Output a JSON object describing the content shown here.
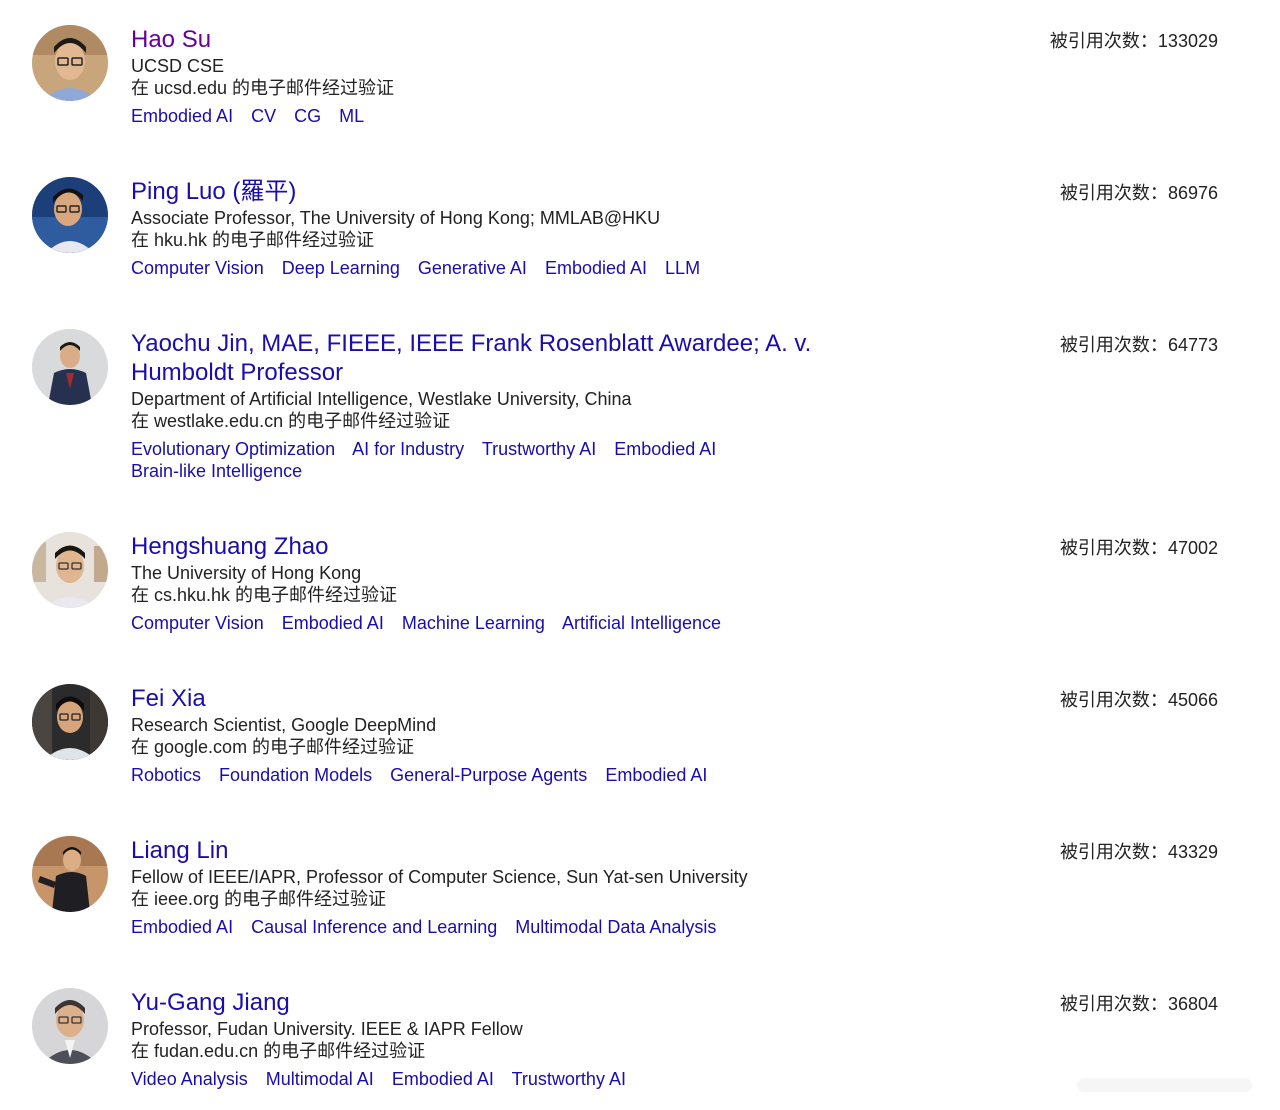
{
  "cite_label": "被引用次数：",
  "profiles": [
    {
      "name": "Hao Su",
      "affiliation": "UCSD CSE",
      "email": "在 ucsd.edu 的电子邮件经过验证",
      "citations": "133029",
      "tags": [
        "Embodied AI",
        "CV",
        "CG",
        "ML"
      ]
    },
    {
      "name": "Ping Luo (羅平)",
      "affiliation": "Associate Professor, The University of Hong Kong; MMLAB@HKU",
      "email": "在 hku.hk 的电子邮件经过验证",
      "citations": "86976",
      "tags": [
        "Computer Vision",
        "Deep Learning",
        "Generative AI",
        "Embodied AI",
        "LLM"
      ]
    },
    {
      "name_lines": [
        "Yaochu Jin, MAE, FIEEE, IEEE Frank Rosenblatt Awardee; A. v.",
        "Humboldt Professor"
      ],
      "affiliation": "Department of Artificial Intelligence, Westlake University, China",
      "email": "在 westlake.edu.cn 的电子邮件经过验证",
      "citations": "64773",
      "tags": [
        "Evolutionary Optimization",
        "AI for Industry",
        "Trustworthy AI",
        "Embodied AI",
        "Brain-like Intelligence"
      ]
    },
    {
      "name": "Hengshuang Zhao",
      "affiliation": "The University of Hong Kong",
      "email": "在 cs.hku.hk 的电子邮件经过验证",
      "citations": "47002",
      "tags": [
        "Computer Vision",
        "Embodied AI",
        "Machine Learning",
        "Artificial Intelligence"
      ]
    },
    {
      "name": "Fei Xia",
      "affiliation": "Research Scientist, Google DeepMind",
      "email": "在 google.com 的电子邮件经过验证",
      "citations": "45066",
      "tags": [
        "Robotics",
        "Foundation Models",
        "General-Purpose Agents",
        "Embodied AI"
      ]
    },
    {
      "name": "Liang Lin",
      "affiliation": "Fellow of IEEE/IAPR, Professor of Computer Science, Sun Yat-sen University",
      "email": "在 ieee.org 的电子邮件经过验证",
      "citations": "43329",
      "tags": [
        "Embodied AI",
        "Causal Inference and Learning",
        "Multimodal Data Analysis"
      ]
    },
    {
      "name": "Yu-Gang Jiang",
      "affiliation": "Professor, Fudan University. IEEE & IAPR Fellow",
      "email": "在 fudan.edu.cn 的电子邮件经过验证",
      "citations": "36804",
      "tags": [
        "Video Analysis",
        "Multimodal AI",
        "Embodied AI",
        "Trustworthy AI"
      ]
    }
  ],
  "colors": {
    "link": "#1a0dab",
    "visited_link": "#660099",
    "text": "#222222"
  }
}
